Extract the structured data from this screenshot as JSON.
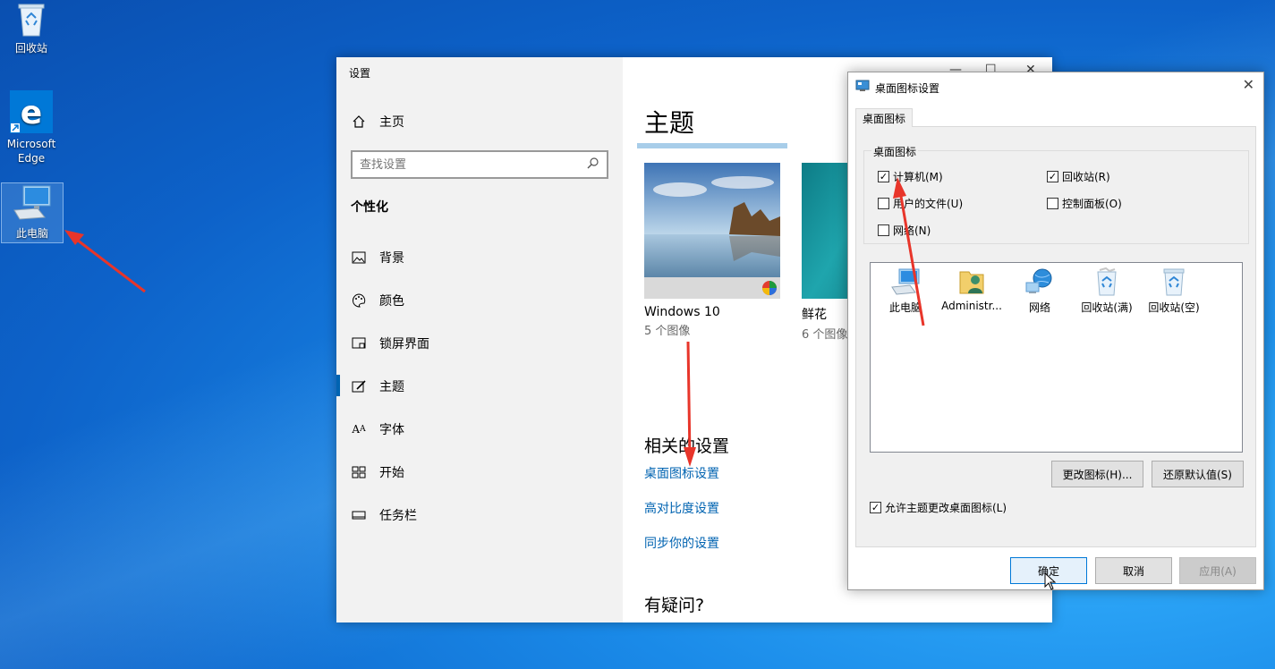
{
  "desktop": {
    "icons": [
      {
        "label": "回收站",
        "icon": "recycle-bin-icon"
      },
      {
        "label": "Microsoft Edge",
        "icon": "edge-icon"
      },
      {
        "label": "此电脑",
        "icon": "computer-icon"
      }
    ]
  },
  "settings": {
    "app_title": "设置",
    "nav_home": "主页",
    "search_placeholder": "查找设置",
    "section": "个性化",
    "nav": [
      {
        "label": "背景",
        "icon": "image-icon"
      },
      {
        "label": "颜色",
        "icon": "palette-icon"
      },
      {
        "label": "锁屏界面",
        "icon": "lockscreen-icon"
      },
      {
        "label": "主题",
        "icon": "theme-brush-icon",
        "selected": true
      },
      {
        "label": "字体",
        "icon": "font-icon"
      },
      {
        "label": "开始",
        "icon": "start-icon"
      },
      {
        "label": "任务栏",
        "icon": "taskbar-icon"
      }
    ],
    "page_title": "主题",
    "themes": [
      {
        "name": "Windows 10",
        "count": "5 个图像"
      },
      {
        "name": "鲜花",
        "count": "6 个图像"
      }
    ],
    "related_heading": "相关的设置",
    "related_links": [
      "桌面图标设置",
      "高对比度设置",
      "同步你的设置"
    ],
    "faq_heading": "有疑问?",
    "accent_color": "#0063b1"
  },
  "dialog": {
    "title": "桌面图标设置",
    "tab": "桌面图标",
    "group_label": "桌面图标",
    "checkboxes": [
      {
        "label": "计算机(M)",
        "checked": true
      },
      {
        "label": "回收站(R)",
        "checked": true
      },
      {
        "label": "用户的文件(U)",
        "checked": false
      },
      {
        "label": "控制面板(O)",
        "checked": false
      },
      {
        "label": "网络(N)",
        "checked": false
      }
    ],
    "icons": [
      {
        "label": "此电脑",
        "icon": "computer-icon"
      },
      {
        "label": "Administr...",
        "icon": "user-folder-icon"
      },
      {
        "label": "网络",
        "icon": "network-icon"
      },
      {
        "label": "回收站(满)",
        "icon": "recycle-bin-full-icon"
      },
      {
        "label": "回收站(空)",
        "icon": "recycle-bin-empty-icon"
      }
    ],
    "change_icon_btn": "更改图标(H)...",
    "restore_default_btn": "还原默认值(S)",
    "allow_theme_label": "允许主题更改桌面图标(L)",
    "allow_theme_checked": true,
    "ok_btn": "确定",
    "cancel_btn": "取消",
    "apply_btn": "应用(A)"
  }
}
